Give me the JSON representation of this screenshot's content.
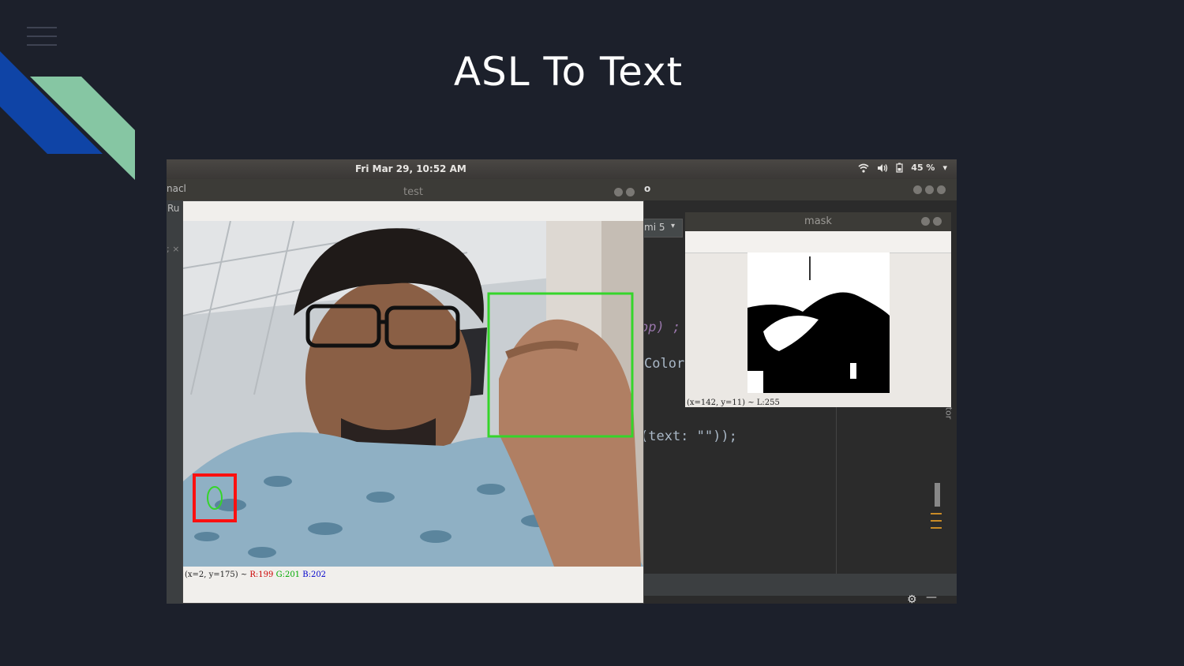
{
  "slide": {
    "title": "ASL To Text",
    "colors": {
      "background": "#1c202b",
      "deco_blue": "#0f44a6",
      "deco_green": "#86c6a3"
    }
  },
  "menu_icon": "hamburger-menu-icon",
  "screenshot": {
    "topbar": {
      "clock": "Fri Mar 29, 10:52 AM",
      "battery": "45 %",
      "icons": [
        "wifi-icon",
        "volume-icon",
        "battery-icon",
        "dropdown-caret-icon"
      ]
    },
    "ide": {
      "title_fragment": "nacl",
      "menu_fragment": "Ru",
      "tab_fragment": "mi 5",
      "tab_close_fragment": "; ×",
      "code_lines": [
        "op) ;",
        "Color",
        "(text: \"\"));"
      ],
      "side_label": "tor",
      "window_title_fragment": "o"
    },
    "test_window": {
      "title": "test",
      "status_prefix": "(x=2, y=175) ~ ",
      "status_r": "R:199",
      "status_g": "G:201",
      "status_b": "B:202"
    },
    "mask_window": {
      "title": "mask",
      "status": "(x=142, y=11) ~ L:255"
    }
  }
}
